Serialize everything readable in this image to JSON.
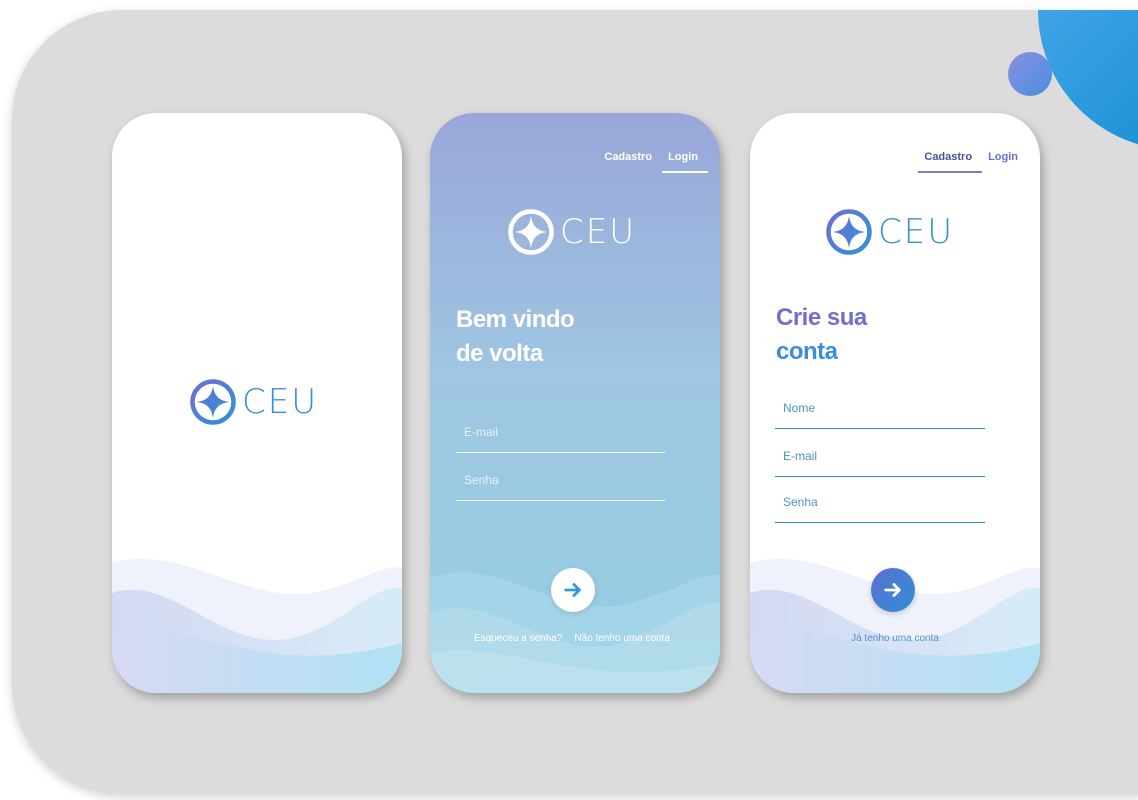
{
  "brand": {
    "logo_text": "CEU",
    "primary_color": "#3a8fd8",
    "secondary_color": "#7370cc"
  },
  "splash": {
    "logo_text": "CEU"
  },
  "login": {
    "tabs": [
      {
        "label": "Cadastro",
        "active": false
      },
      {
        "label": "Login",
        "active": true
      }
    ],
    "logo_text": "CEU",
    "headline": [
      "Bem vindo",
      "de volta"
    ],
    "email_placeholder": "E-mail",
    "password_placeholder": "Senha",
    "submit_icon": "arrow-right-icon",
    "forgot_link": "Esqueceu a senha?",
    "no_account_link": "Não tenho uma conta"
  },
  "signup": {
    "tabs": [
      {
        "label": "Cadastro",
        "active": true
      },
      {
        "label": "Login",
        "active": false
      }
    ],
    "logo_text": "CEU",
    "headline": [
      "Crie sua",
      "conta"
    ],
    "name_placeholder": "Nome",
    "email_placeholder": "E-mail",
    "password_placeholder": "Senha",
    "submit_icon": "arrow-right-icon",
    "have_account_link": "Já tenho uma conta"
  }
}
